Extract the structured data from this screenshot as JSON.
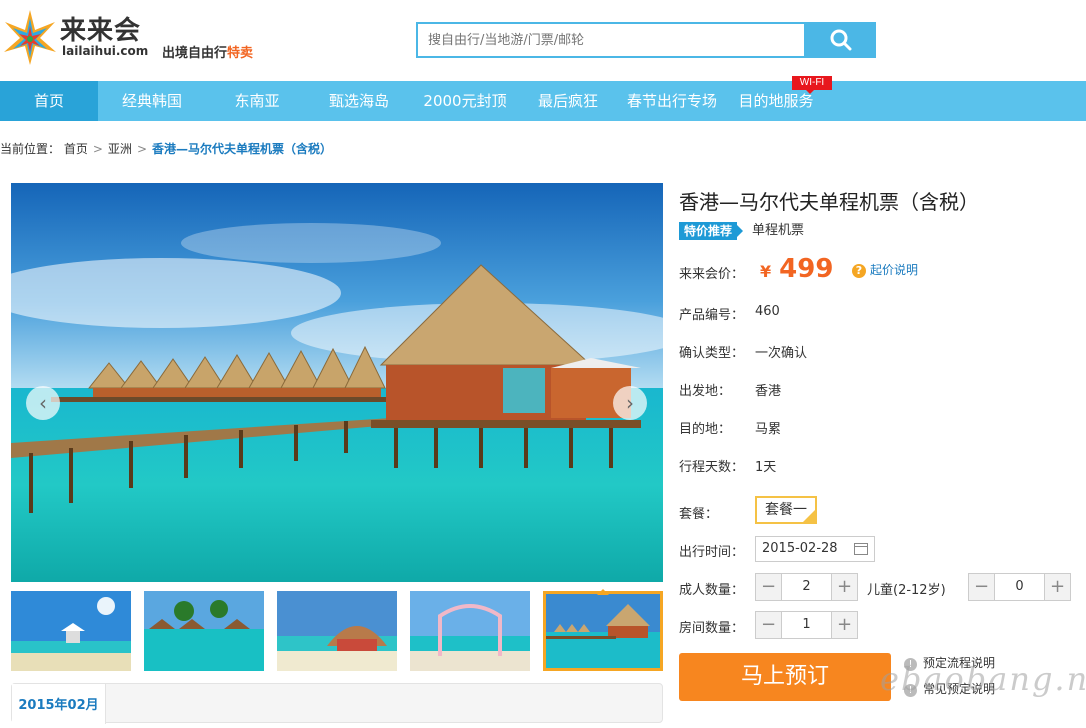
{
  "brand": {
    "name_cn": "来来会",
    "name_en": "lailaihui.com",
    "slogan_main": "出境自由行",
    "slogan_em": "特卖"
  },
  "search": {
    "placeholder": "搜自由行/当地游/门票/邮轮"
  },
  "nav": {
    "items": [
      "首页",
      "经典韩国",
      "东南亚",
      "甄选海岛",
      "2000元封顶",
      "最后疯狂",
      "春节出行专场",
      "目的地服务"
    ],
    "badge": "WI-FI",
    "active_index": 0
  },
  "breadcrumb": {
    "label": "当前位置：",
    "items": [
      "首页",
      "亚洲"
    ],
    "separator": ">",
    "current": "香港—马尔代夫单程机票（含税）"
  },
  "gallery": {
    "thumb_count": 5,
    "selected_index": 4,
    "prev": "‹",
    "next": "›"
  },
  "calendar": {
    "month": "2015年02月"
  },
  "product": {
    "title": "香港—马尔代夫单程机票（含税）",
    "tag": "特价推荐",
    "category": "单程机票",
    "price_label": "来来会价：",
    "currency": "¥",
    "price": "499",
    "price_help": "起价说明",
    "fields": [
      {
        "label": "产品编号：",
        "value": "460"
      },
      {
        "label": "确认类型：",
        "value": "一次确认"
      },
      {
        "label": "出发地：",
        "value": "香港"
      },
      {
        "label": "目的地：",
        "value": "马累"
      },
      {
        "label": "行程天数：",
        "value": "1天"
      }
    ]
  },
  "booking": {
    "package_label": "套餐：",
    "package_value": "套餐一",
    "date_label": "出行时间：",
    "date_value": "2015-02-28",
    "adult_label": "成人数量：",
    "adult_value": "2",
    "child_label": "儿童(2-12岁)",
    "child_value": "0",
    "room_label": "房间数量：",
    "room_value": "1",
    "book_button": "马上预订",
    "links": [
      "预定流程说明",
      "常见预定说明"
    ]
  },
  "watermark": "ebaobang.net",
  "colors": {
    "nav": "#5ac2ec",
    "nav_active": "#29a3d8",
    "price": "#f26522",
    "book": "#f7861f",
    "accent": "#f5a623"
  }
}
